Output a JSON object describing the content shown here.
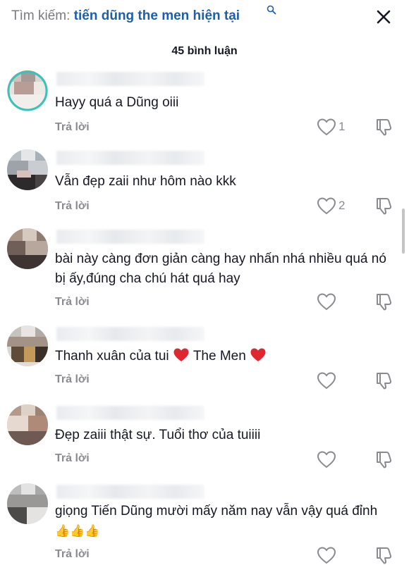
{
  "header": {
    "search_label": "Tìm kiếm: ",
    "search_query": "tiến dũng the men hiện tại"
  },
  "comments_count": "45 bình luận",
  "comments": [
    {
      "text": "Hayy quá a Dũng oiii",
      "reply": "Trả lời",
      "likes": "1"
    },
    {
      "text": "Vẫn đẹp zaii như hôm nào kkk",
      "reply": "Trả lời",
      "likes": "2"
    },
    {
      "text": "bài này càng đơn giản càng hay nhấn nhá nhiều quá nó bị ấy,đúng cha chú hát quá hay",
      "reply": "Trả lời",
      "likes": ""
    },
    {
      "text_before": "Thanh xuân của tui ",
      "text_mid": " The Men ",
      "reply": "Trả lời",
      "likes": ""
    },
    {
      "text": "Đẹp zaiii thật sự. Tuổi thơ của tuiiii",
      "reply": "Trả lời",
      "likes": ""
    },
    {
      "text": "giọng Tiến Dũng mười mấy năm nay vẫn vậy quá đỉnh",
      "reply": "Trả lời",
      "likes": ""
    }
  ],
  "colors": {
    "query": "#1f5fa8",
    "muted": "#8a8b91",
    "text": "#161823",
    "heart_emoji": "#e0262f"
  }
}
